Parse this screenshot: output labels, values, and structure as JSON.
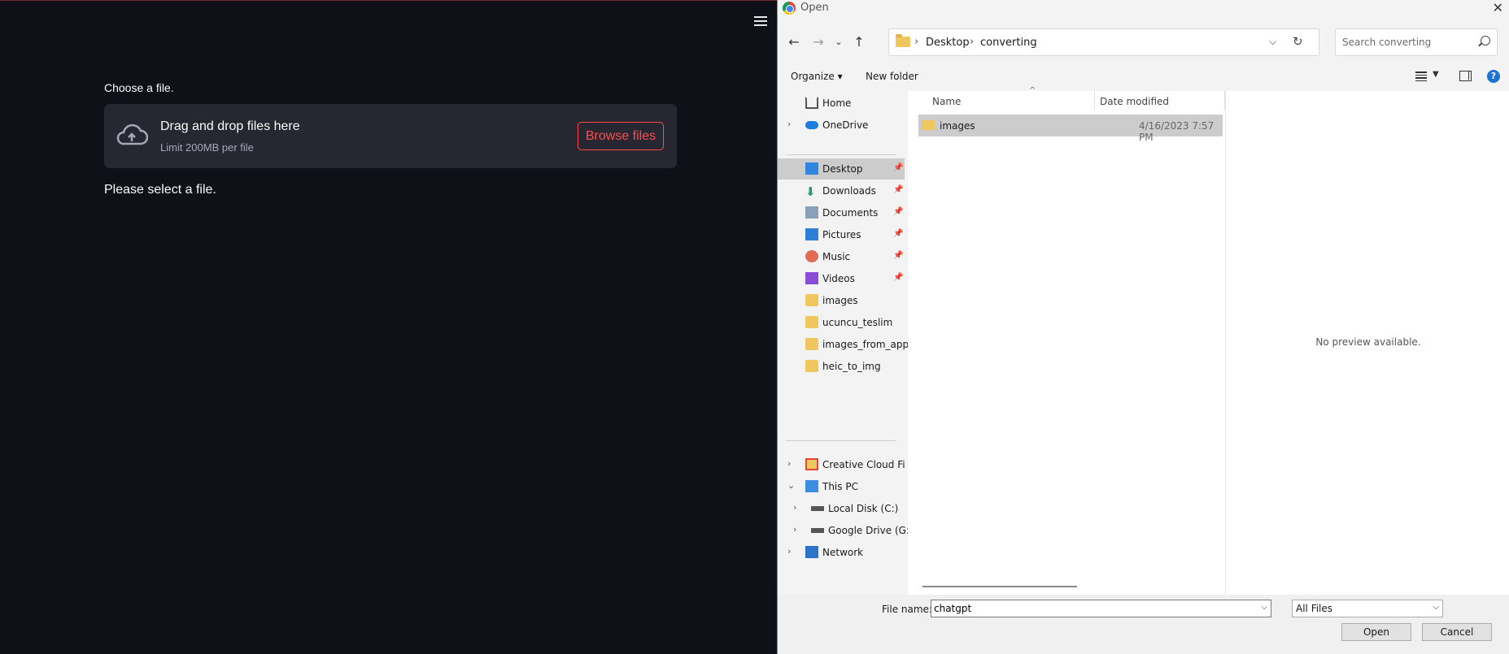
{
  "app": {
    "choose_label": "Choose a file.",
    "dropzone_title": "Drag and drop files here",
    "dropzone_subtitle": "Limit 200MB per file",
    "browse_button": "Browse files",
    "status_text": "Please select a file.",
    "accent_color": "#ff4b4b"
  },
  "dialog": {
    "title": "Open",
    "breadcrumb": [
      "Desktop",
      "converting"
    ],
    "search_placeholder": "Search converting",
    "toolbar": {
      "organize": "Organize ▾",
      "new_folder": "New folder"
    },
    "nav_items": [
      {
        "label": "Home",
        "icon": "home-icon"
      },
      {
        "label": "OneDrive",
        "icon": "onedrive-icon"
      },
      {
        "label": "Desktop",
        "icon": "desktop-icon"
      },
      {
        "label": "Downloads",
        "icon": "downloads-icon"
      },
      {
        "label": "Documents",
        "icon": "documents-icon"
      },
      {
        "label": "Pictures",
        "icon": "pictures-icon"
      },
      {
        "label": "Music",
        "icon": "music-icon"
      },
      {
        "label": "Videos",
        "icon": "videos-icon"
      },
      {
        "label": "images",
        "icon": "folder-icon"
      },
      {
        "label": "ucuncu_teslim",
        "icon": "folder-icon"
      },
      {
        "label": "images_from_app",
        "icon": "folder-icon"
      },
      {
        "label": "heic_to_img",
        "icon": "folder-icon"
      },
      {
        "label": "Creative Cloud Files",
        "icon": "creative-cloud-icon"
      },
      {
        "label": "This PC",
        "icon": "pc-icon"
      },
      {
        "label": "Local Disk (C:)",
        "icon": "drive-icon"
      },
      {
        "label": "Google Drive (G:)",
        "icon": "drive-icon"
      },
      {
        "label": "Network",
        "icon": "network-icon"
      }
    ],
    "columns": {
      "name": "Name",
      "date": "Date modified"
    },
    "files": [
      {
        "name": "images",
        "date": "4/16/2023 7:57 PM"
      }
    ],
    "preview_text": "No preview available.",
    "file_name_label": "File name:",
    "file_name_value": "chatgpt",
    "file_type": "All Files",
    "open_button": "Open",
    "cancel_button": "Cancel"
  }
}
